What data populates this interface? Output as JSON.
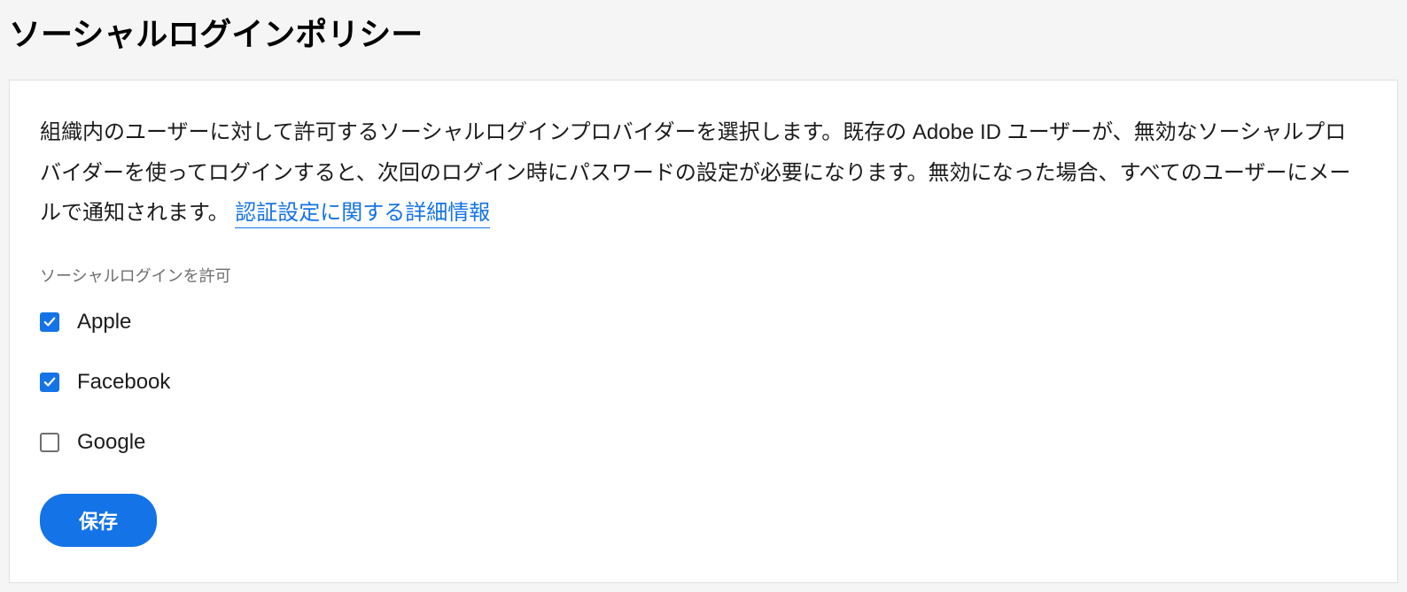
{
  "title": "ソーシャルログインポリシー",
  "description": {
    "text_before_link": "組織内のユーザーに対して許可するソーシャルログインプロバイダーを選択します。既存の Adobe ID ユーザーが、無効なソーシャルプロバイダーを使ってログインすると、次回のログイン時にパスワードの設定が必要になります。無効になった場合、すべてのユーザーにメールで通知されます。 ",
    "link_text": "認証設定に関する詳細情報"
  },
  "section_label": "ソーシャルログインを許可",
  "providers": [
    {
      "name": "Apple",
      "checked": true
    },
    {
      "name": "Facebook",
      "checked": true
    },
    {
      "name": "Google",
      "checked": false
    }
  ],
  "save_button_label": "保存"
}
